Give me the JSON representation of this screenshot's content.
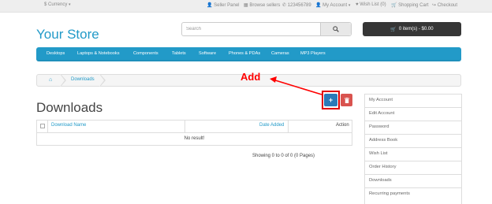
{
  "topbar": {
    "currency": "$ Currency",
    "seller_panel": "Seller Panel",
    "browse_sellers": "Browse sellers",
    "phone": "123456789",
    "my_account": "My Account",
    "wish_list": "Wish List (0)",
    "shopping_cart": "Shopping Cart",
    "checkout": "Checkout"
  },
  "header": {
    "logo": "Your Store",
    "search_placeholder": "Search",
    "cart_label": "0 item(s) - $0.00"
  },
  "menu": {
    "items": [
      "Desktops",
      "Laptops & Notebooks",
      "Components",
      "Tablets",
      "Software",
      "Phones & PDAs",
      "Cameras",
      "MP3 Players"
    ]
  },
  "breadcrumb": {
    "current": "Downloads"
  },
  "annotation": {
    "label": "Add"
  },
  "page": {
    "title": "Downloads"
  },
  "table": {
    "columns": [
      "Download Name",
      "Date Added",
      "Action"
    ],
    "empty_message": "No result!"
  },
  "pagination": {
    "text": "Showing 0 to 0 of 0 (0 Pages)"
  },
  "account_menu": {
    "items": [
      "My Account",
      "Edit Account",
      "Password",
      "Address Book",
      "Wish List",
      "Order History",
      "Downloads",
      "Recurring payments"
    ]
  },
  "colors": {
    "brand": "#229ac8",
    "add_button": "#2a7ab8",
    "delete_button": "#d9534f",
    "annotation": "#ff0000"
  }
}
